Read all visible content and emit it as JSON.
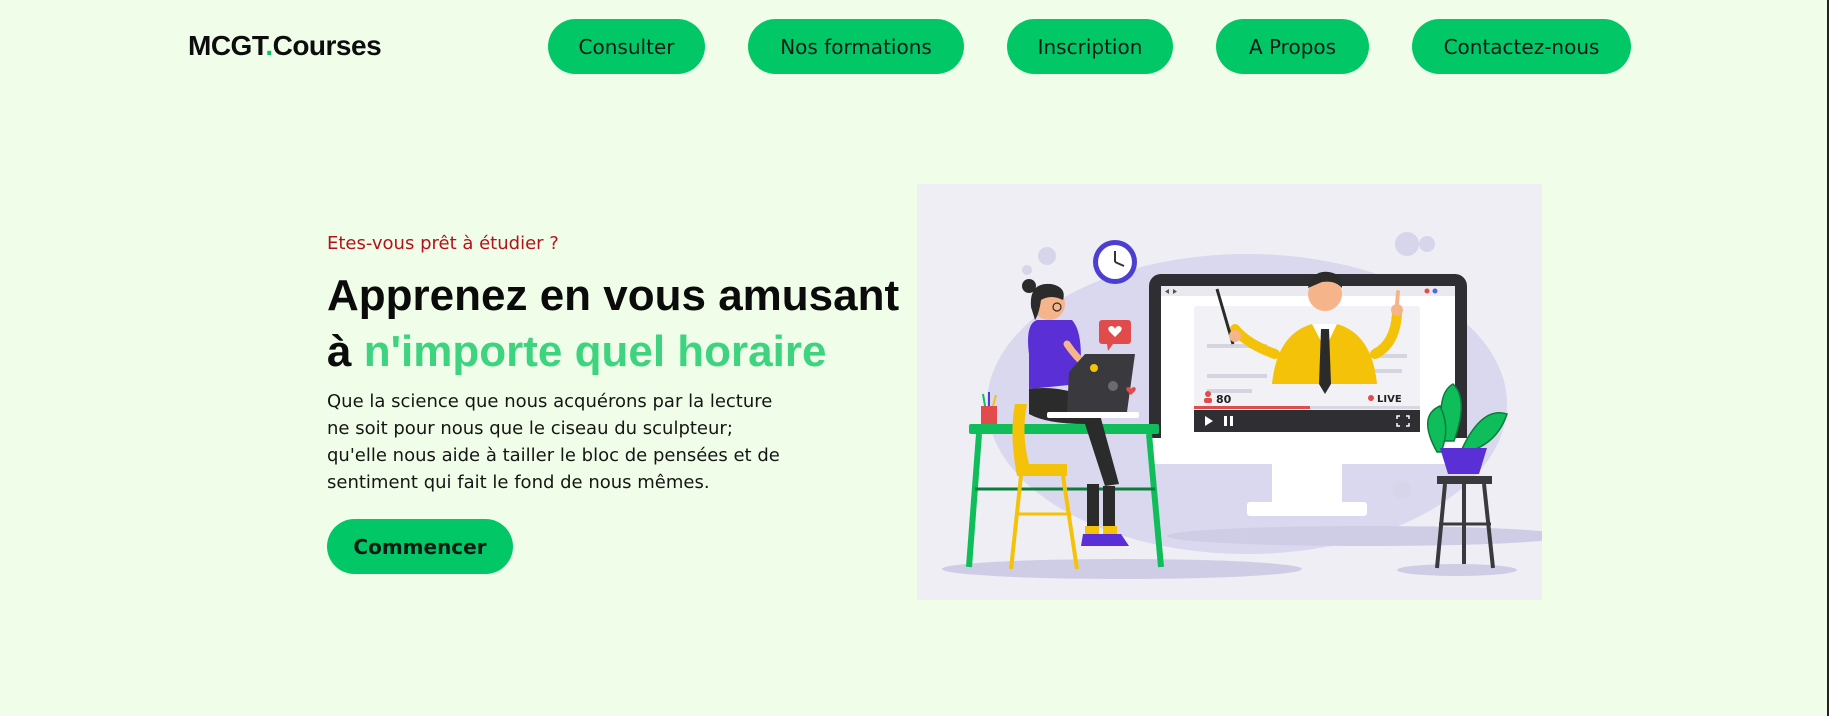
{
  "header": {
    "logo_main": "MCGT",
    "logo_dot": ".",
    "logo_suffix": "Courses",
    "nav": [
      {
        "label": "Consulter"
      },
      {
        "label": "Nos formations"
      },
      {
        "label": "Inscription"
      },
      {
        "label": "A Propos"
      },
      {
        "label": "Contactez-nous"
      }
    ]
  },
  "hero": {
    "eyebrow": "Etes-vous prêt à étudier ?",
    "headline_line1": "Apprenez en vous amusant",
    "headline_line2_prefix": "à ",
    "headline_line2_accent": "n'importe quel horaire",
    "body_lines": [
      "Que la science que nous acquérons par la lecture",
      "ne soit pour nous que le ciseau du sculpteur;",
      "qu'elle nous aide à tailler le bloc de pensées et de",
      "sentiment qui fait le fond de nous mêmes."
    ],
    "cta_label": "Commencer"
  },
  "illustration": {
    "viewer_count": "80",
    "live_label": "LIVE",
    "icons": [
      "clock-icon",
      "heart-icon",
      "play-icon",
      "pause-icon",
      "fullscreen-icon",
      "person-icon"
    ]
  },
  "colors": {
    "background": "#f0fee9",
    "accent": "#02c767",
    "headline_accent": "#3ed37f",
    "eyebrow": "#b3121c"
  }
}
